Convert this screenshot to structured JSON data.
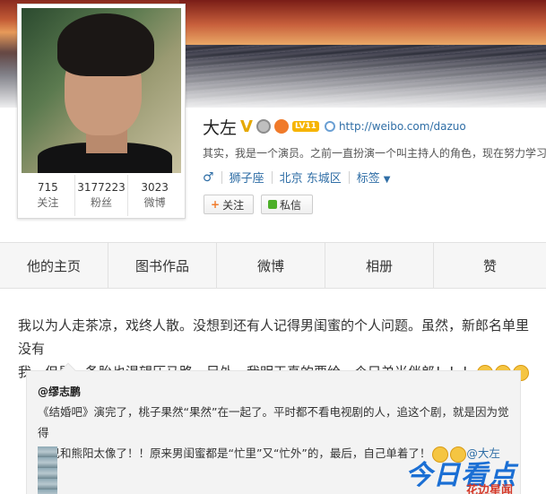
{
  "profile": {
    "name": "大左",
    "level": "LV11",
    "homepage": "http://weibo.com/dazuo",
    "bio": "其实，我是一个演员。之前一直扮演一个叫主持人的角色，现在努力学习",
    "zodiac": "狮子座",
    "location": "北京 东城区",
    "tags_label": "标签",
    "stats": [
      {
        "num": "715",
        "label": "关注"
      },
      {
        "num": "3177223",
        "label": "粉丝"
      },
      {
        "num": "3023",
        "label": "微博"
      }
    ],
    "follow_label": "关注",
    "message_label": "私信"
  },
  "tabs": [
    {
      "label": "他的主页"
    },
    {
      "label": "图书作品"
    },
    {
      "label": "微博"
    },
    {
      "label": "相册"
    },
    {
      "label": "赞"
    }
  ],
  "post": {
    "text_line1": "我以为人走茶凉，戏终人散。没想到还有人记得男闺蜜的个人问题。虽然，新郎名单里没有",
    "text_line2": "我。但是，备胎也渴望压马路…另外，我明天真的要给一个兄弟当伴郎！！！",
    "repost": {
      "author": "@缪志鹏",
      "line1": "《结婚吧》演完了，桃子果然“果然”在一起了。平时都不看电视剧的人，追这个剧，就是因为觉得",
      "line2": "自己和熊阳太像了！！原来男闺蜜都是“忙里”又“忙外”的，最后，自己单着了！",
      "mention": "@大左"
    }
  },
  "watermark": {
    "main": "今日看点",
    "sub": "花边星闻"
  },
  "colors": {
    "link": "#2f6ea6",
    "watermark": "#1b6fd4"
  }
}
